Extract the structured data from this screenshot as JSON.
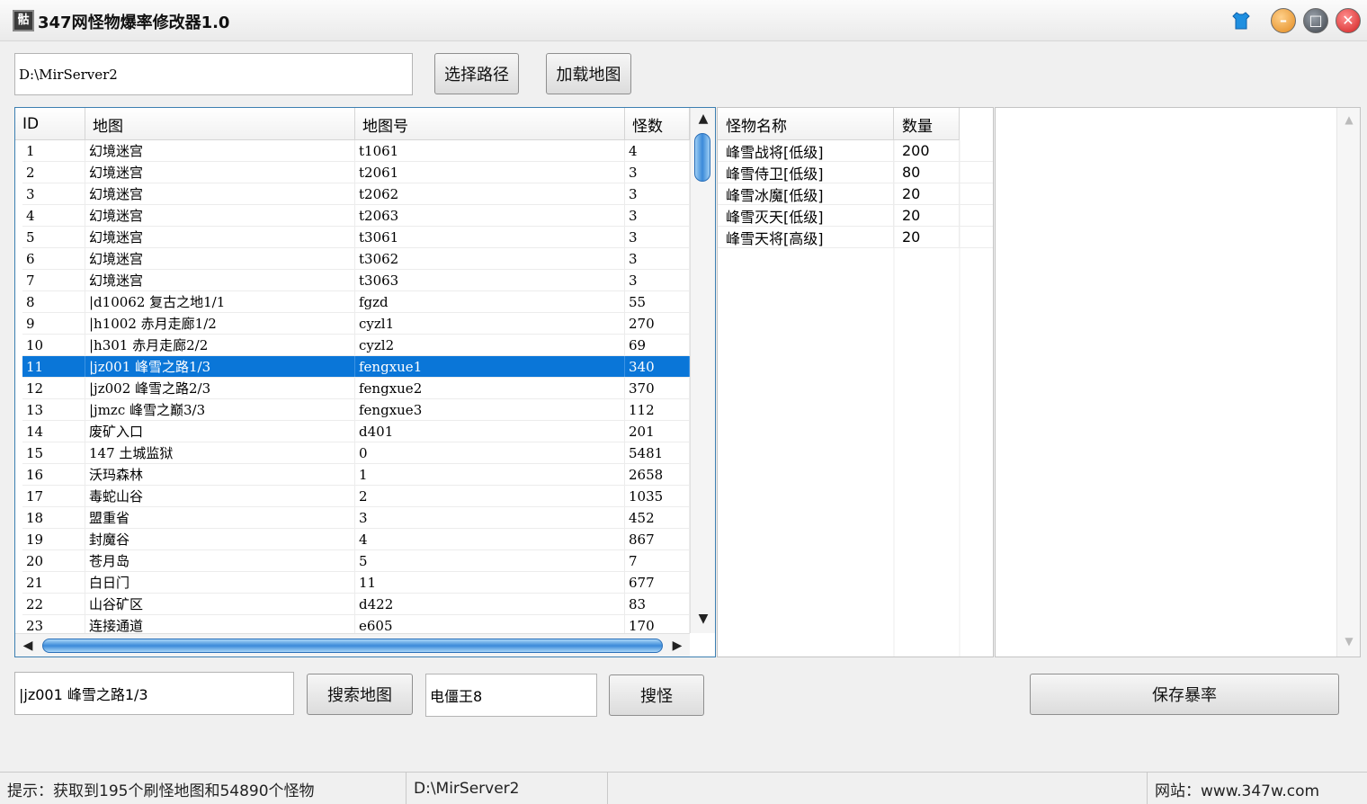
{
  "window": {
    "title": "347网怪物爆率修改器1.0",
    "icon_text": "骷",
    "controls": [
      "skin-icon",
      "minimize-icon",
      "maximize-icon",
      "close-icon"
    ]
  },
  "path_bar": {
    "path_value": "D:\\MirServer2",
    "select_path_label": "选择路径",
    "load_map_label": "加载地图"
  },
  "map_list": {
    "columns": [
      "ID",
      "地图",
      "地图号",
      "怪数"
    ],
    "selected_index": 10,
    "rows": [
      [
        "1",
        " 幻境迷宫",
        "t1061",
        "4"
      ],
      [
        "2",
        " 幻境迷宫",
        "t2061",
        "3"
      ],
      [
        "3",
        " 幻境迷宫",
        "t2062",
        "3"
      ],
      [
        "4",
        " 幻境迷宫",
        "t2063",
        "3"
      ],
      [
        "5",
        " 幻境迷宫",
        "t3061",
        "3"
      ],
      [
        "6",
        " 幻境迷宫",
        "t3062",
        "3"
      ],
      [
        "7",
        " 幻境迷宫",
        "t3063",
        "3"
      ],
      [
        "8",
        "|d10062 复古之地1/1",
        "fgzd",
        "55"
      ],
      [
        "9",
        "|h1002 赤月走廊1/2",
        "cyzl1",
        "270"
      ],
      [
        "10",
        "|h301 赤月走廊2/2",
        "cyzl2",
        "69"
      ],
      [
        "11",
        "|jz001 峰雪之路1/3",
        "fengxue1",
        "340"
      ],
      [
        "12",
        "|jz002 峰雪之路2/3",
        "fengxue2",
        "370"
      ],
      [
        "13",
        "|jmzc 峰雪之巅3/3",
        "fengxue3",
        "112"
      ],
      [
        "14",
        " 废矿入口",
        "d401",
        "201"
      ],
      [
        "15",
        "147 土城监狱",
        "0",
        "5481"
      ],
      [
        "16",
        " 沃玛森林",
        "1",
        "2658"
      ],
      [
        "17",
        " 毒蛇山谷",
        "2",
        "1035"
      ],
      [
        "18",
        " 盟重省",
        "3",
        "452"
      ],
      [
        "19",
        " 封魔谷",
        "4",
        "867"
      ],
      [
        "20",
        " 苍月岛",
        "5",
        "7"
      ],
      [
        "21",
        " 白日门",
        "11",
        "677"
      ],
      [
        "22",
        " 山谷矿区",
        "d422",
        "83"
      ],
      [
        "23",
        " 连接通道",
        "e605",
        "170"
      ]
    ]
  },
  "monster_list": {
    "columns": [
      "怪物名称",
      "数量"
    ],
    "rows": [
      [
        "峰雪战将[低级]",
        "200"
      ],
      [
        "峰雪侍卫[低级]",
        "80"
      ],
      [
        "峰雪冰魔[低级]",
        "20"
      ],
      [
        "峰雪灭天[低级]",
        "20"
      ],
      [
        "峰雪天将[高级]",
        "20"
      ]
    ]
  },
  "search_bar": {
    "map_search_value": "|jz001 峰雪之路1/3",
    "search_map_label": "搜索地图",
    "monster_search_value": "电僵王8",
    "search_monster_label": "搜怪",
    "save_rate_label": "保存暴率"
  },
  "status_bar": {
    "hint": "提示：获取到195个刷怪地图和54890个怪物",
    "path": "D:\\MirServer2",
    "website": "网站：www.347w.com"
  },
  "colors": {
    "selection": "#0a76d8",
    "list_border": "#3c7fb1",
    "scroll_thumb": "#3b8ad9"
  }
}
